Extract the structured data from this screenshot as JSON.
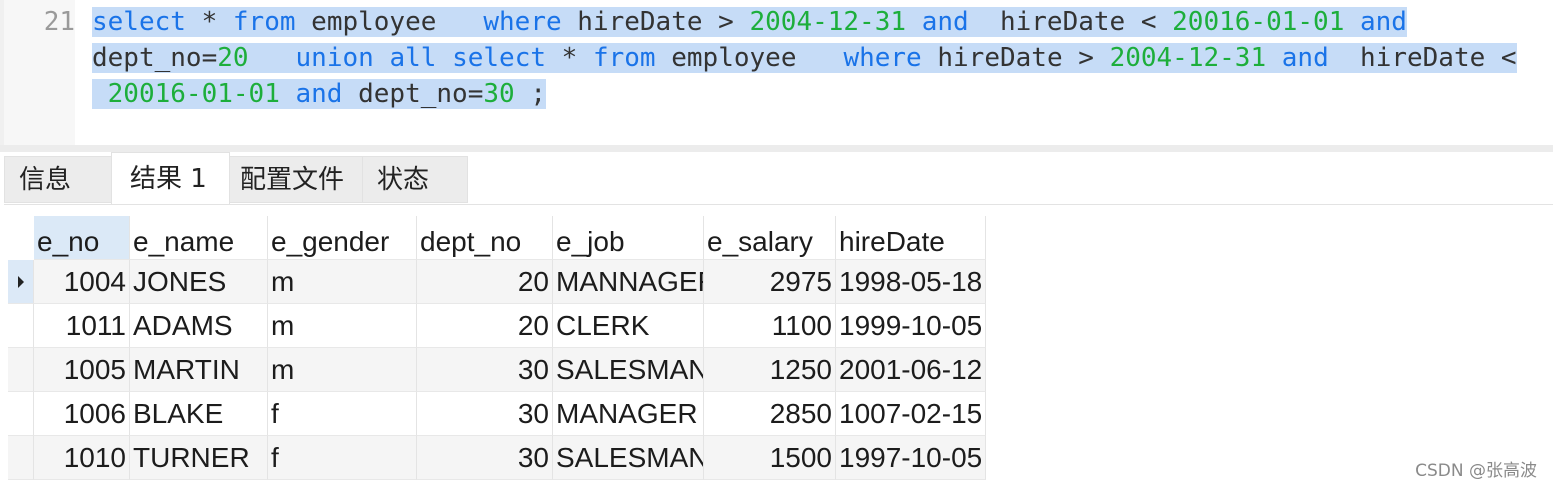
{
  "editor": {
    "line_number": "21",
    "lines": [
      [
        {
          "t": "select",
          "c": "kw"
        },
        {
          "t": " * ",
          "c": "plain"
        },
        {
          "t": "from",
          "c": "kw"
        },
        {
          "t": " employee   ",
          "c": "plain"
        },
        {
          "t": "where",
          "c": "kw"
        },
        {
          "t": " hireDate > ",
          "c": "plain"
        },
        {
          "t": "2004-12-31",
          "c": "lit"
        },
        {
          "t": " ",
          "c": "plain"
        },
        {
          "t": "and",
          "c": "kw"
        },
        {
          "t": "  hireDate < ",
          "c": "plain"
        },
        {
          "t": "20016-01-01",
          "c": "lit"
        },
        {
          "t": " ",
          "c": "plain"
        },
        {
          "t": "and",
          "c": "kw"
        }
      ],
      [
        {
          "t": "dept_no=",
          "c": "plain"
        },
        {
          "t": "20",
          "c": "lit"
        },
        {
          "t": "   ",
          "c": "plain"
        },
        {
          "t": "union",
          "c": "kw"
        },
        {
          "t": " ",
          "c": "plain"
        },
        {
          "t": "all",
          "c": "kw"
        },
        {
          "t": " ",
          "c": "plain"
        },
        {
          "t": "select",
          "c": "kw"
        },
        {
          "t": " * ",
          "c": "plain"
        },
        {
          "t": "from",
          "c": "kw"
        },
        {
          "t": " employee   ",
          "c": "plain"
        },
        {
          "t": "where",
          "c": "kw"
        },
        {
          "t": " hireDate > ",
          "c": "plain"
        },
        {
          "t": "2004-12-31",
          "c": "lit"
        },
        {
          "t": " ",
          "c": "plain"
        },
        {
          "t": "and",
          "c": "kw"
        },
        {
          "t": "  hireDate <",
          "c": "plain"
        }
      ],
      [
        {
          "t": " ",
          "c": "plain"
        },
        {
          "t": "20016-01-01",
          "c": "lit"
        },
        {
          "t": " ",
          "c": "plain"
        },
        {
          "t": "and",
          "c": "kw"
        },
        {
          "t": " dept_no=",
          "c": "plain"
        },
        {
          "t": "30",
          "c": "lit"
        },
        {
          "t": " ;",
          "c": "plain"
        }
      ]
    ]
  },
  "tabs": [
    {
      "label": "信息",
      "active": false
    },
    {
      "label": "结果 1",
      "active": true
    },
    {
      "label": "配置文件",
      "active": false
    },
    {
      "label": "状态",
      "active": false
    }
  ],
  "grid": {
    "columns": [
      {
        "name": "e_no",
        "align": "num"
      },
      {
        "name": "e_name",
        "align": "txt"
      },
      {
        "name": "e_gender",
        "align": "txt"
      },
      {
        "name": "dept_no",
        "align": "num"
      },
      {
        "name": "e_job",
        "align": "txt"
      },
      {
        "name": "e_salary",
        "align": "num"
      },
      {
        "name": "hireDate",
        "align": "txt"
      }
    ],
    "rows": [
      [
        "1004",
        "JONES",
        "m",
        "20",
        "MANNAGER",
        "2975",
        "1998-05-18"
      ],
      [
        "1011",
        "ADAMS",
        "m",
        "20",
        "CLERK",
        "1100",
        "1999-10-05"
      ],
      [
        "1005",
        "MARTIN",
        "m",
        "30",
        "SALESMAN",
        "1250",
        "2001-06-12"
      ],
      [
        "1006",
        "BLAKE",
        "f",
        "30",
        "MANAGER",
        "2850",
        "1007-02-15"
      ],
      [
        "1010",
        "TURNER",
        "f",
        "30",
        "SALESMAN",
        "1500",
        "1997-10-05"
      ]
    ],
    "current_row": 0
  },
  "watermark": "CSDN @张高波",
  "colors": {
    "keyword": "#1a73e8",
    "literal": "#1dae3b",
    "selection": "#c6dcf7"
  }
}
